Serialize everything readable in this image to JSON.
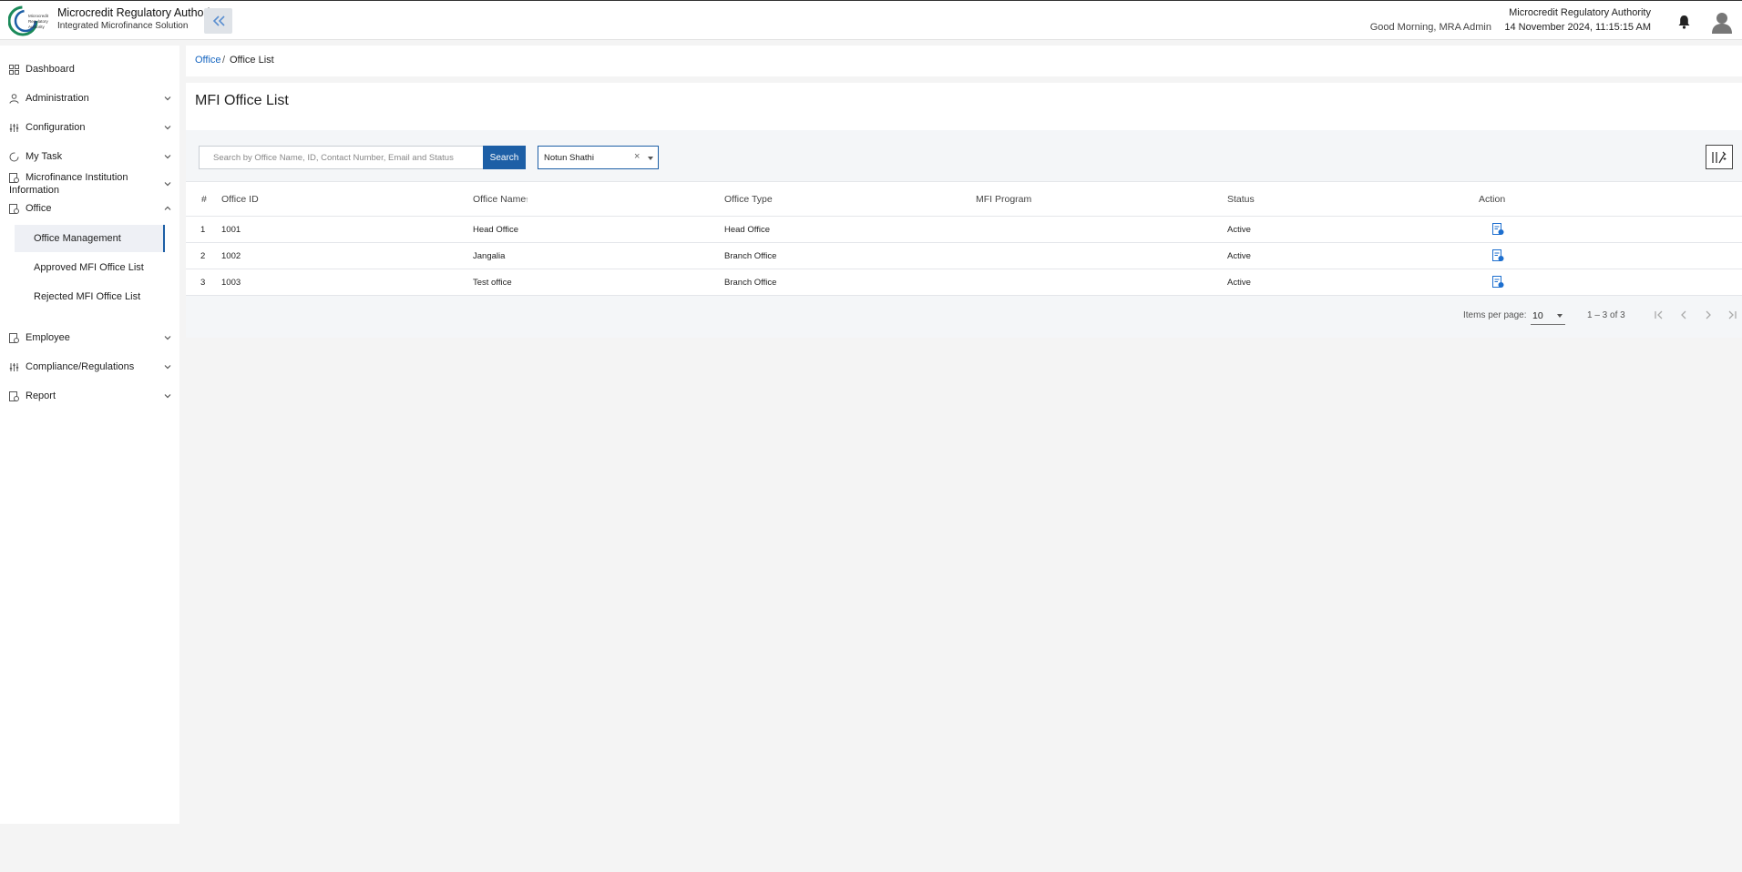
{
  "header": {
    "logo_text": "Microcredit Regulatory Authority",
    "title": "Microcredit Regulatory Authority",
    "subtitle": "Integrated Microfinance Solution",
    "greeting": "Good Morning, MRA Admin",
    "org_name": "Microcredit Regulatory Authority",
    "datetime": "14 November 2024, 11:15:15 AM",
    "icons": {
      "collapse": "double-chevron-left-icon",
      "notifications": "bell-icon",
      "profile": "user-avatar-icon"
    }
  },
  "sidebar": {
    "items": [
      {
        "label": "Dashboard",
        "icon": "dashboard-icon",
        "expandable": false
      },
      {
        "label": "Administration",
        "icon": "admin-icon",
        "expandable": true
      },
      {
        "label": "Configuration",
        "icon": "sliders-icon",
        "expandable": true
      },
      {
        "label": "My Task",
        "icon": "task-icon",
        "expandable": true
      },
      {
        "label": "Microfinance Institution",
        "label2": "Information",
        "icon": "institution-icon",
        "expandable": true
      },
      {
        "label": "Office",
        "icon": "office-icon",
        "expandable": true,
        "expanded": true
      },
      {
        "label": "Employee",
        "icon": "employee-icon",
        "expandable": true
      },
      {
        "label": "Compliance/Regulations",
        "icon": "sliders-icon",
        "expandable": true
      },
      {
        "label": "Report",
        "icon": "report-icon",
        "expandable": true
      }
    ],
    "office_children": [
      {
        "label": "Office Management",
        "active": true
      },
      {
        "label": "Approved MFI Office List",
        "active": false
      },
      {
        "label": "Rejected MFI Office List",
        "active": false
      }
    ]
  },
  "breadcrumb": {
    "parent": "Office",
    "separator": "/",
    "current": "Office List"
  },
  "page": {
    "title": "MFI Office List"
  },
  "search": {
    "placeholder": "Search by Office Name, ID, Contact Number, Email and Status",
    "value": "",
    "button_label": "Search"
  },
  "filter": {
    "selected": "Notun Shathi",
    "clear_symbol": "×"
  },
  "table": {
    "columns": [
      "#",
      "Office ID",
      "Office Name",
      "Office Type",
      "MFI Program",
      "Status",
      "Action"
    ],
    "sort_indicator": "↑",
    "rows": [
      {
        "index": "1",
        "office_id": "1001",
        "office_name": "Head Office",
        "office_type": "Head Office",
        "mfi_program": "",
        "status": "Active"
      },
      {
        "index": "2",
        "office_id": "1002",
        "office_name": "Jangalia",
        "office_type": "Branch Office",
        "mfi_program": "",
        "status": "Active"
      },
      {
        "index": "3",
        "office_id": "1003",
        "office_name": "Test office",
        "office_type": "Branch Office",
        "mfi_program": "",
        "status": "Active"
      }
    ]
  },
  "paginator": {
    "items_per_page_label": "Items per page:",
    "items_per_page": "10",
    "range": "1 – 3 of 3"
  },
  "colors": {
    "accent": "#1d5fa6",
    "link": "#1565c0",
    "background": "#f4f4f4"
  }
}
